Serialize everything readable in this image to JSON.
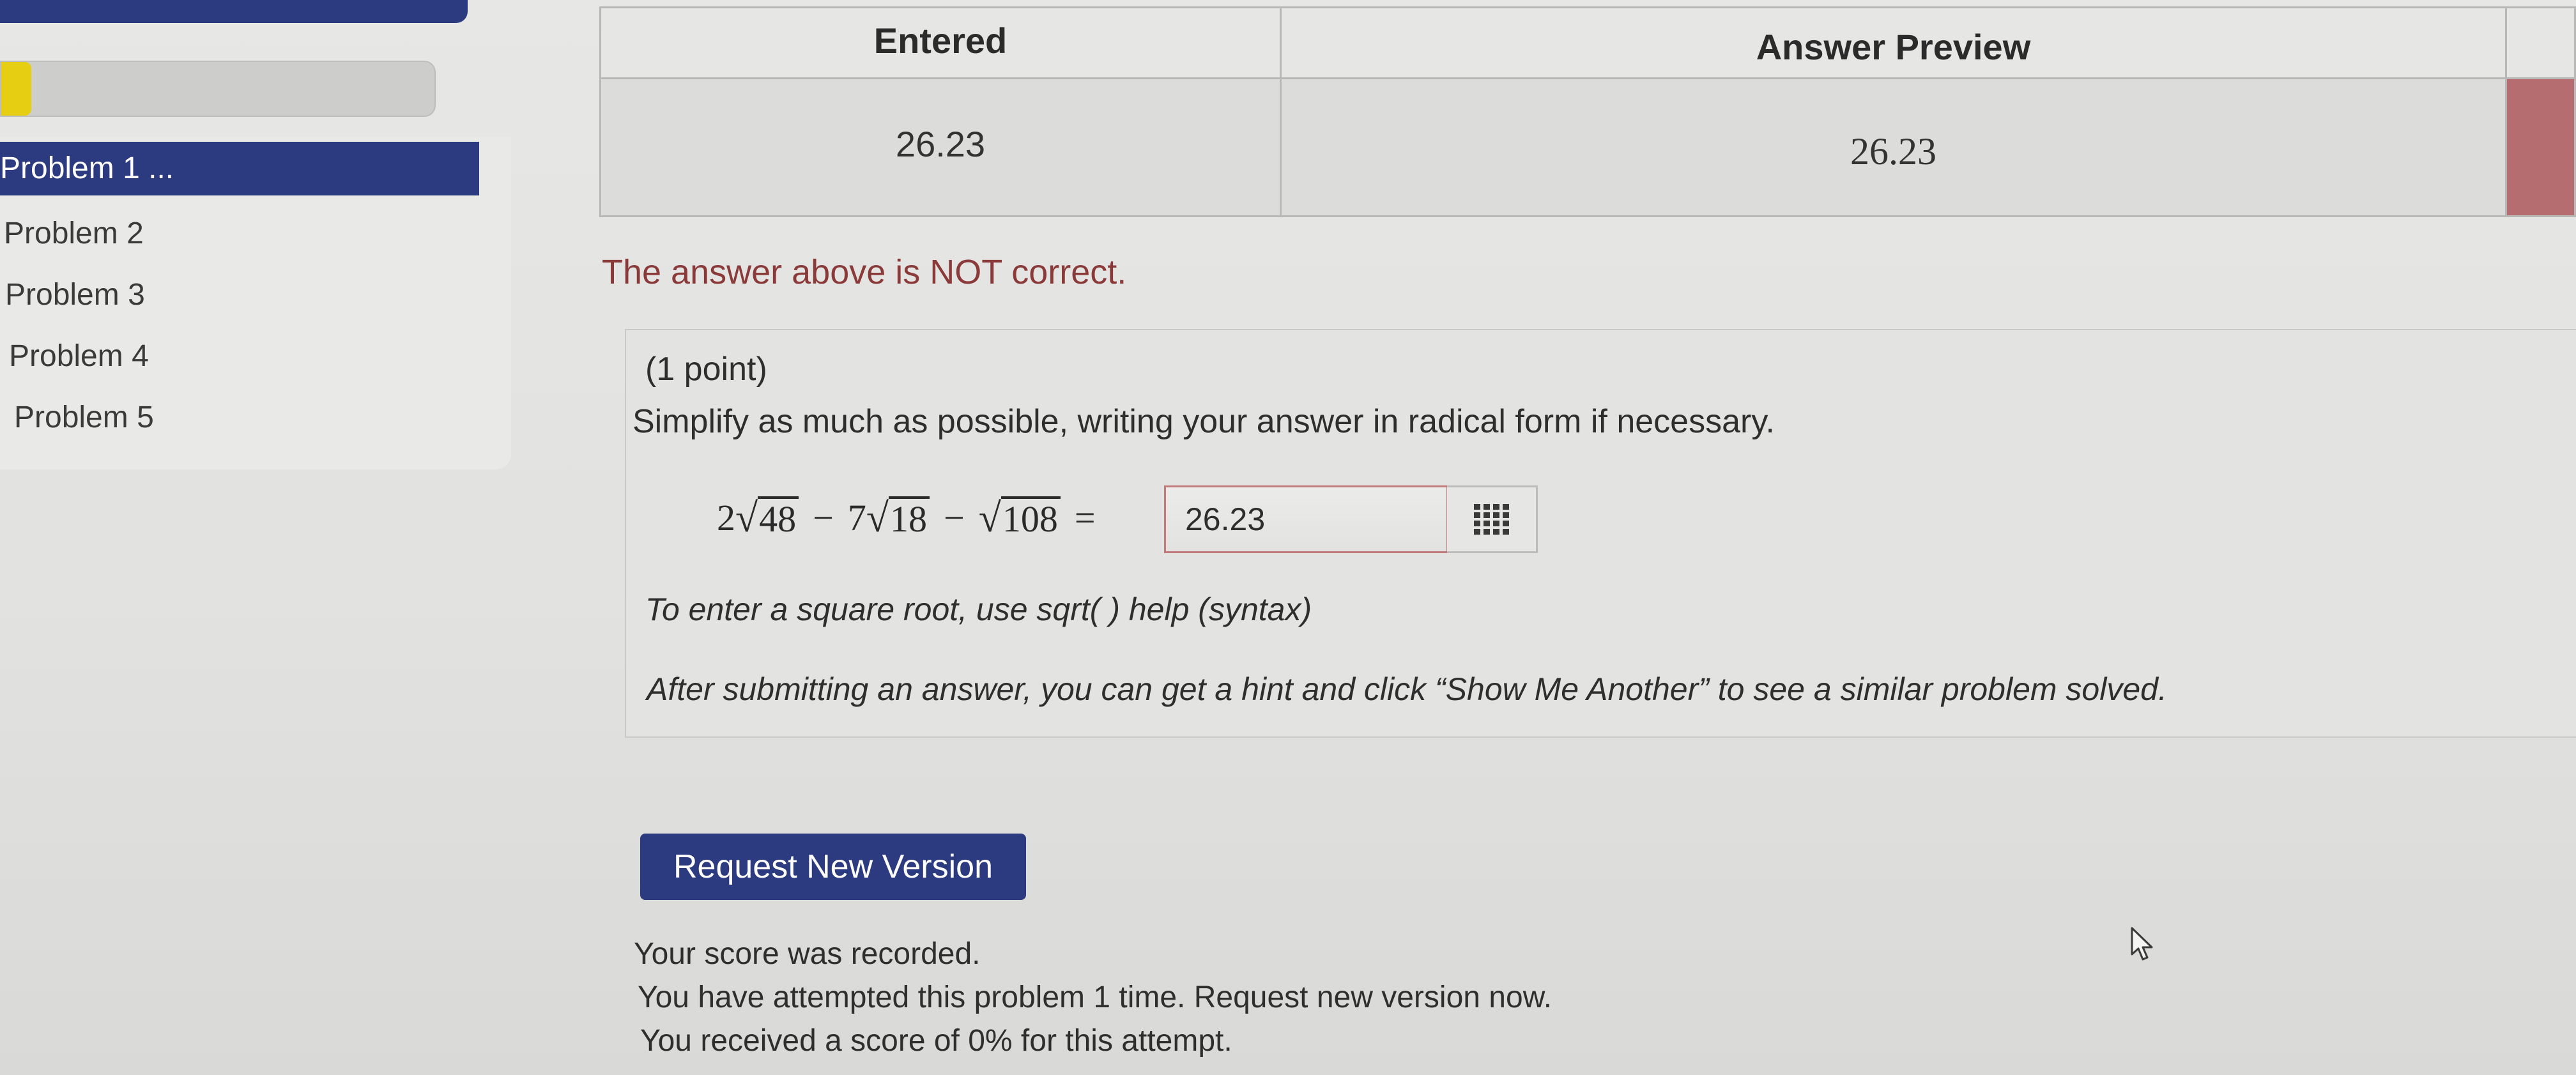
{
  "sidebar": {
    "progress_fraction": 0.07,
    "problems": [
      {
        "label": "Problem 1 ...",
        "active": true
      },
      {
        "label": "Problem 2",
        "active": false
      },
      {
        "label": "Problem 3",
        "active": false
      },
      {
        "label": "Problem 4",
        "active": false
      },
      {
        "label": "Problem 5",
        "active": false
      }
    ]
  },
  "results": {
    "headers": {
      "entered": "Entered",
      "preview": "Answer Preview"
    },
    "row": {
      "entered": "26.23",
      "preview": "26.23",
      "status_color": "#b56d70"
    }
  },
  "feedback": {
    "message": "The answer above is NOT correct."
  },
  "problem": {
    "points": "(1 point)",
    "instruction": "Simplify as much as possible, writing your answer in radical form if necessary.",
    "equation": {
      "coef1": "2",
      "radicand1": "48",
      "minus1": "−",
      "coef2": "7",
      "radicand2": "18",
      "minus2": "−",
      "radicand3": "108",
      "equals": "="
    },
    "answer_value": "26.23",
    "hint_text": "To enter a square root, use sqrt( ) ",
    "help_link": "help (syntax)",
    "after_submit": "After submitting an answer, you can get a hint and click “Show Me Another” to see a similar problem solved."
  },
  "request_button_label": "Request New Version",
  "score": {
    "recorded": "Your score was recorded.",
    "attempts": "You have attempted this problem 1 time. Request new version now.",
    "received": "You received a score of 0% for this attempt."
  },
  "colors": {
    "brand": "#2c3a80",
    "incorrect": "#b56d70",
    "progress": "#e6cf12"
  },
  "icons": {
    "palette": "grid-icon",
    "cursor": "mouse-pointer-icon"
  }
}
